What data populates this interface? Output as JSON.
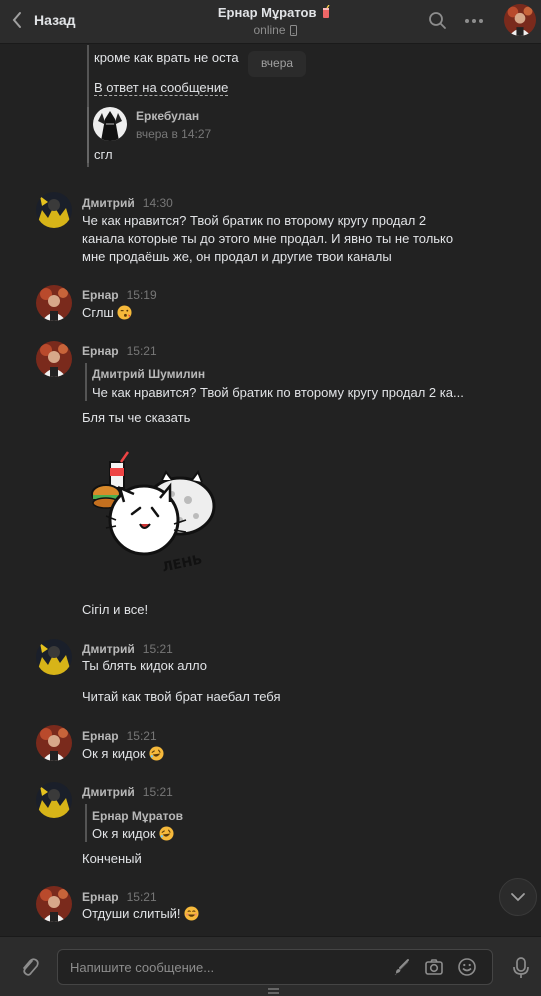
{
  "header": {
    "back_label": "Назад",
    "peer_name": "Ернар Мұратов",
    "peer_status": "online"
  },
  "chat": {
    "top_partial_text": "кроме как врать не оста",
    "date_tooltip": "вчера",
    "reply_link": "В ответ на сообщение",
    "reply_quote": {
      "name": "Еркебулан",
      "time": "вчера в 14:27",
      "text": "сгл"
    },
    "messages": [
      {
        "sender": "Дмитрий",
        "time": "14:30",
        "lines": [
          "Че как нравится? Твой братик по второму кругу продал 2",
          "канала которые ты до этого мне продал. И явно ты не только",
          "мне продаёшь же, он продал и другие твои каналы"
        ]
      },
      {
        "sender": "Ернар",
        "time": "15:19",
        "text": "Сглш"
      },
      {
        "sender": "Ернар",
        "time": "15:21",
        "fwd_name": "Дмитрий Шумилин",
        "fwd_text": "Че как нравится? Твой братик по второму кругу продал 2 ка...",
        "text": "Бля ты че сказать",
        "sticker_text": "ЛЕНЬ",
        "text2": "Сігіл и все!"
      },
      {
        "sender": "Дмитрий",
        "time": "15:21",
        "text": "Ты блять кидок алло",
        "text2": "Читай как твой брат наебал тебя"
      },
      {
        "sender": "Ернар",
        "time": "15:21",
        "text": "Ок я кидок"
      },
      {
        "sender": "Дмитрий",
        "time": "15:21",
        "fwd_name": "Ернар Мұратов",
        "fwd_text": "Ок я кидок",
        "text": "Конченый"
      },
      {
        "sender": "Ернар",
        "time": "15:21",
        "text": "Отдуши слитый!"
      }
    ]
  },
  "composer": {
    "placeholder": "Напишите сообщение..."
  },
  "icons": [
    "back-chevron-icon",
    "search-icon",
    "more-icon",
    "phone-icon",
    "paperclip-icon",
    "brush-icon",
    "camera-icon",
    "smile-icon",
    "mic-icon",
    "chevron-down-icon"
  ],
  "colors": {
    "background": "#222222",
    "panel": "#2c2c2c",
    "text": "#e1e3e6",
    "muted": "#8d8d8d"
  }
}
